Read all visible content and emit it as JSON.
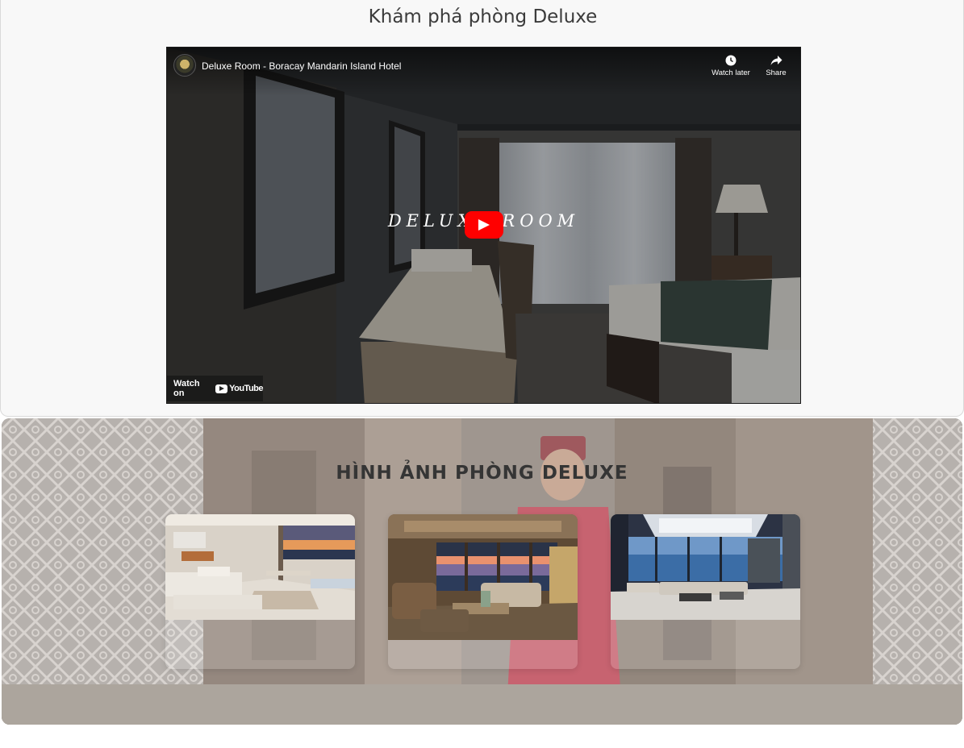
{
  "page_title": "Khám phá phòng Deluxe",
  "video": {
    "title": "Deluxe Room - Boracay Mandarin Island Hotel",
    "overlay_text": "DELUXE ROOM",
    "watch_later_label": "Watch later",
    "share_label": "Share",
    "watch_on_label": "Watch on",
    "youtube_label": "YouTube"
  },
  "gallery": {
    "title": "HÌNH ẢNH PHÒNG DELUXE",
    "images": [
      {
        "name": "room-photo-1"
      },
      {
        "name": "room-photo-2"
      },
      {
        "name": "room-photo-3"
      }
    ]
  },
  "colors": {
    "page_bg": "#f8f8f8",
    "youtube_red": "#ff0000",
    "heading": "#3b3b3b"
  }
}
